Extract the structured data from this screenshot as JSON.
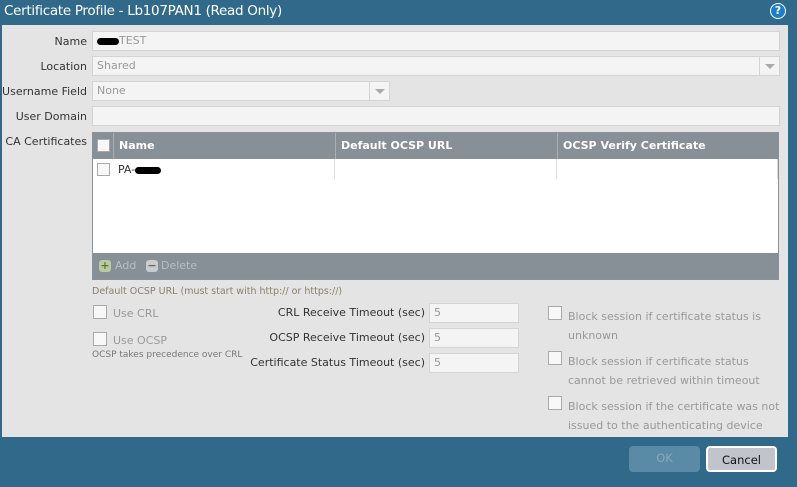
{
  "window": {
    "title": "Certificate Profile - Lb107PAN1 (Read Only)",
    "help_icon": "?"
  },
  "form": {
    "name_label": "Name",
    "name_value": "TEST",
    "location_label": "Location",
    "location_value": "Shared",
    "username_label": "Username Field",
    "username_value": "None",
    "domain_label": "User Domain",
    "domain_value": "",
    "ca_label": "CA Certificates"
  },
  "table": {
    "columns": [
      "Name",
      "Default OCSP URL",
      "OCSP Verify Certificate"
    ],
    "rows": [
      {
        "name": "PA-",
        "ocsp_url": "",
        "verify": ""
      }
    ],
    "add_label": "Add",
    "delete_label": "Delete"
  },
  "hint_ocsp_url": "Default OCSP URL (must start with http:// or https://)",
  "options": {
    "use_crl": "Use CRL",
    "use_ocsp": "Use OCSP",
    "ocsp_note": "OCSP takes precedence over CRL"
  },
  "timeouts": {
    "crl_label": "CRL Receive Timeout (sec)",
    "crl_value": "5",
    "ocsp_label": "OCSP Receive Timeout (sec)",
    "ocsp_value": "5",
    "status_label": "Certificate Status Timeout (sec)",
    "status_value": "5"
  },
  "block": {
    "unknown": "Block session if certificate status is unknown",
    "timeout": "Block session if certificate status cannot be retrieved within timeout",
    "not_issued": "Block session if the certificate was not issued to the authenticating device"
  },
  "buttons": {
    "ok": "OK",
    "cancel": "Cancel"
  }
}
